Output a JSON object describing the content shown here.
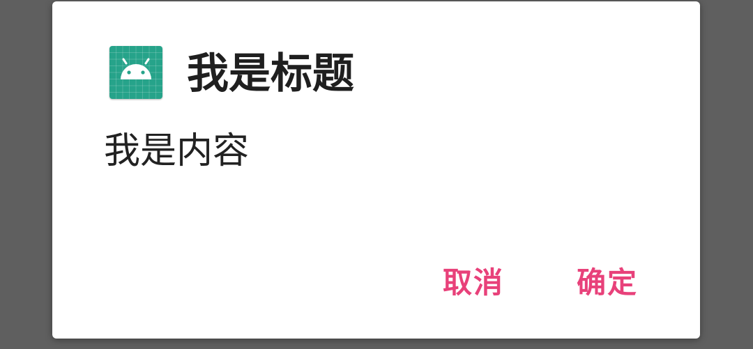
{
  "dialog": {
    "title": "我是标题",
    "message": "我是内容",
    "icon": "android-robot-icon",
    "negative_button": "取消",
    "positive_button": "确定"
  },
  "colors": {
    "scrim": "#5f5f5f",
    "dialog_background": "#ffffff",
    "icon_background": "#26a38a",
    "accent": "#e8417a",
    "title_text": "#1f1f1f"
  }
}
